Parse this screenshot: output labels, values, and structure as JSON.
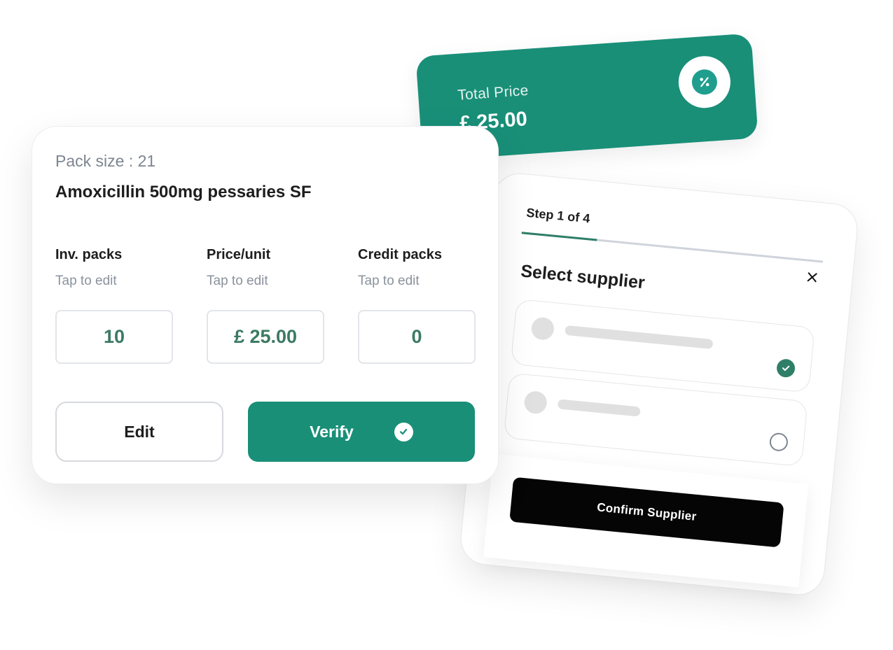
{
  "price_card": {
    "label": "Total Price",
    "amount": "£ 25.00",
    "badge_icon": "percent-icon",
    "color": "#198f78"
  },
  "supplier_card": {
    "step_label": "Step 1 of 4",
    "progress_fraction": 0.25,
    "title": "Select supplier",
    "options": [
      {
        "selected": true
      },
      {
        "selected": false
      }
    ],
    "confirm_label": "Confirm Supplier"
  },
  "medication_card": {
    "pack_size": "Pack size : 21",
    "product_name": "Amoxicillin 500mg pessaries SF",
    "fields": [
      {
        "label": "Inv. packs",
        "hint": "Tap to edit",
        "value": "10"
      },
      {
        "label": "Price/unit",
        "hint": "Tap to edit",
        "value": "£ 25.00"
      },
      {
        "label": "Credit packs",
        "hint": "Tap to edit",
        "value": "0"
      }
    ],
    "edit_label": "Edit",
    "verify_label": "Verify"
  },
  "colors": {
    "accent": "#198f78",
    "value_text": "#3b7a63",
    "confirm_button": "#050505"
  }
}
